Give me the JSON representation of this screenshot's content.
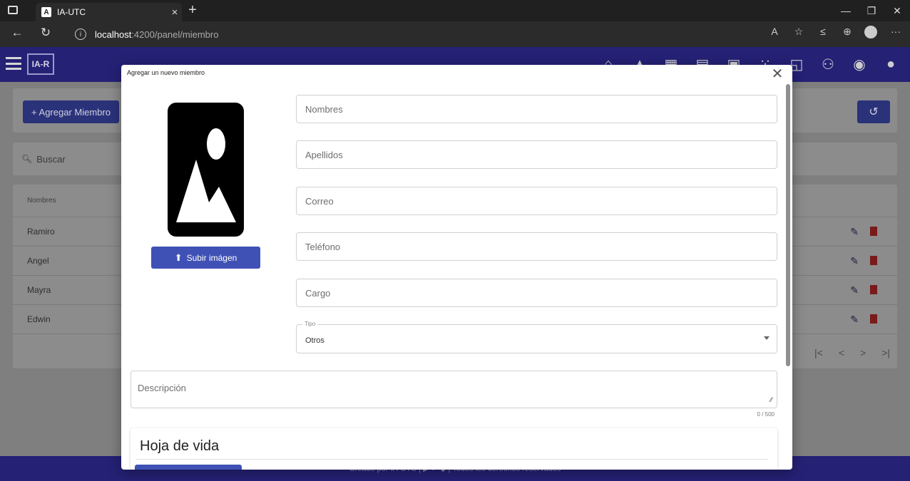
{
  "browser": {
    "tab_title": "IA-UTC",
    "tab_favicon": "A",
    "url_host": "localhost",
    "url_path": ":4200/panel/miembro",
    "icons": [
      "read-aloud-icon",
      "favorite-icon",
      "favorites-bar-icon",
      "collections-icon",
      "profile-icon",
      "more-icon"
    ]
  },
  "app": {
    "logo": "IA-R",
    "header_icons": [
      "home-icon",
      "graduation-cap-icon",
      "chart-menu-icon",
      "table-menu-icon",
      "gallery-icon",
      "members-icon",
      "news-icon",
      "group-icon",
      "eye-icon",
      "account-icon"
    ],
    "add_member_label": "+ Agregar Miembro",
    "search_placeholder": "Buscar",
    "table_header": "Nombres",
    "rows": [
      {
        "name": "Ramiro"
      },
      {
        "name": "Angel"
      },
      {
        "name": "Mayra"
      },
      {
        "name": "Edwin"
      }
    ],
    "paginator": [
      "|<",
      "<",
      ">",
      ">|"
    ],
    "footer_text": "Creado por IA-UTC | ▶ ✔ ◆ | Todos los derechos reservados"
  },
  "modal": {
    "title": "Agregar un nuevo miembro",
    "upload_label": "Subir imágen",
    "fields": {
      "nombres": "Nombres",
      "apellidos": "Apellidos",
      "correo": "Correo",
      "telefono": "Teléfono",
      "cargo": "Cargo"
    },
    "tipo_label": "Tipo",
    "tipo_value": "Otros",
    "descripcion_label": "Descripción",
    "descripcion_counter": "0 / 500",
    "cv_title": "Hoja de vida"
  },
  "colors": {
    "header": "#252175",
    "primary_button": "#3f51b5",
    "overlay_page": "#7f7f7f"
  }
}
